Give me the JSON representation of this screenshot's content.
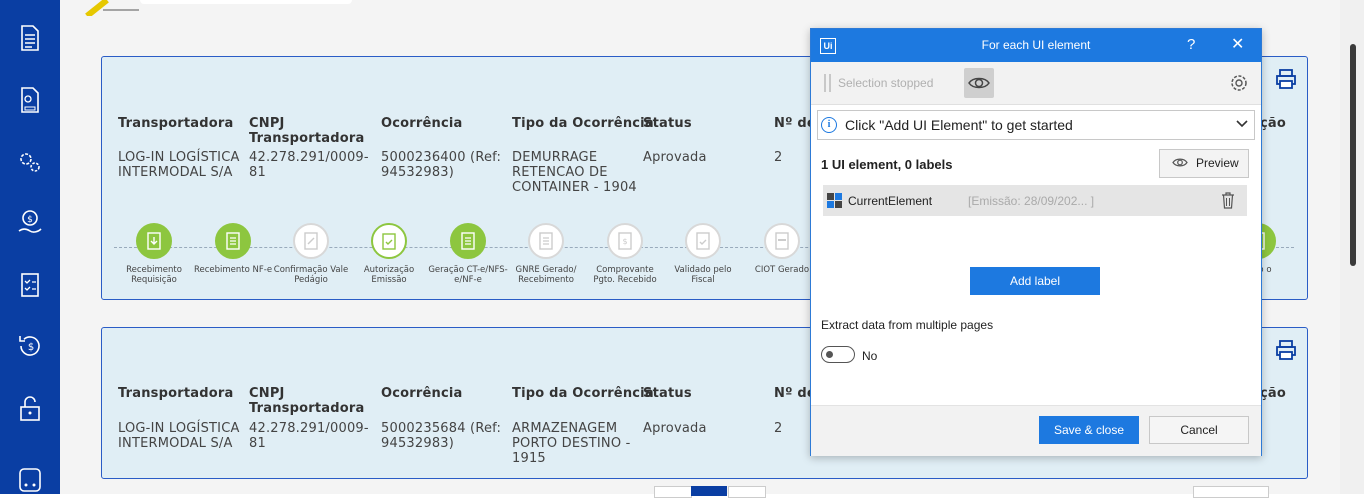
{
  "sidebar": {
    "icons": [
      "document-icon",
      "file-settings-icon",
      "gears-icon",
      "money-hand-icon",
      "checklist-icon",
      "refund-icon",
      "unlock-icon",
      "truck-icon"
    ]
  },
  "cards": [
    {
      "headers": [
        "Transportadora",
        "CNPJ Transportadora",
        "Ocorrência",
        "Tipo da Ocorrência",
        "Status",
        "Nº de",
        "ção"
      ],
      "values": {
        "transportadora": "LOG-IN LOGÍSTICA INTERMODAL S/A",
        "cnpj": "42.278.291/0009-81",
        "ocorrencia": "5000236400 (Ref: 94532983)",
        "tipo": "DEMURRAGE RETENCAO DE CONTAINER - 1904",
        "status": "Aprovada",
        "num": "2"
      },
      "steps": [
        {
          "label": "Recebimento Requisição",
          "state": "done",
          "icon": "download-doc-icon"
        },
        {
          "label": "Recebimento NF-e",
          "state": "done",
          "icon": "doc-lines-icon"
        },
        {
          "label": "Confirmação Vale Pedágio",
          "state": "pending",
          "icon": "doc-edit-icon"
        },
        {
          "label": "Autorização Emissão",
          "state": "current",
          "icon": "clipboard-check-icon"
        },
        {
          "label": "Geração CT-e/NFS-e/NF-e",
          "state": "done",
          "icon": "doc-lines-icon"
        },
        {
          "label": "GNRE Gerado/ Recebimento",
          "state": "pending",
          "icon": "doc-lines-icon"
        },
        {
          "label": "Comprovante Pgto. Recebido",
          "state": "pending",
          "icon": "doc-money-icon"
        },
        {
          "label": "Validado pelo Fiscal",
          "state": "pending",
          "icon": "doc-check-icon"
        },
        {
          "label": "CIOT Gerado",
          "state": "pending",
          "icon": "ciot-icon"
        },
        {
          "label": "ento o",
          "state": "done",
          "icon": "doc-lines-icon"
        }
      ]
    },
    {
      "headers": [
        "Transportadora",
        "CNPJ Transportadora",
        "Ocorrência",
        "Tipo da Ocorrência",
        "Status",
        "Nº de",
        "ção"
      ],
      "values": {
        "transportadora": "LOG-IN LOGÍSTICA INTERMODAL S/A",
        "cnpj": "42.278.291/0009-81",
        "ocorrencia": "5000235684 (Ref: 94532983)",
        "tipo": "ARMAZENAGEM PORTO DESTINO - 1915",
        "status": "Aprovada",
        "num": "2"
      }
    }
  ],
  "dialog": {
    "logo": "Ui",
    "title": "For each UI element",
    "help": "?",
    "close": "✕",
    "selection_status": "Selection stopped",
    "info_text": "Click \"Add UI Element\" to get started",
    "count_text": "1 UI element, 0 labels",
    "preview_label": "Preview",
    "element_name": "CurrentElement",
    "element_value": "[Emissão: 28/09/202... ]",
    "add_label": "Add label",
    "extract_label": "Extract data from multiple pages",
    "toggle_value": "No",
    "save_label": "Save & close",
    "cancel_label": "Cancel"
  },
  "colors": {
    "sidebar": "#0a3ea3",
    "accent": "#1d79e0",
    "step_done": "#8dc63f",
    "card_bg": "#e0eef5"
  }
}
